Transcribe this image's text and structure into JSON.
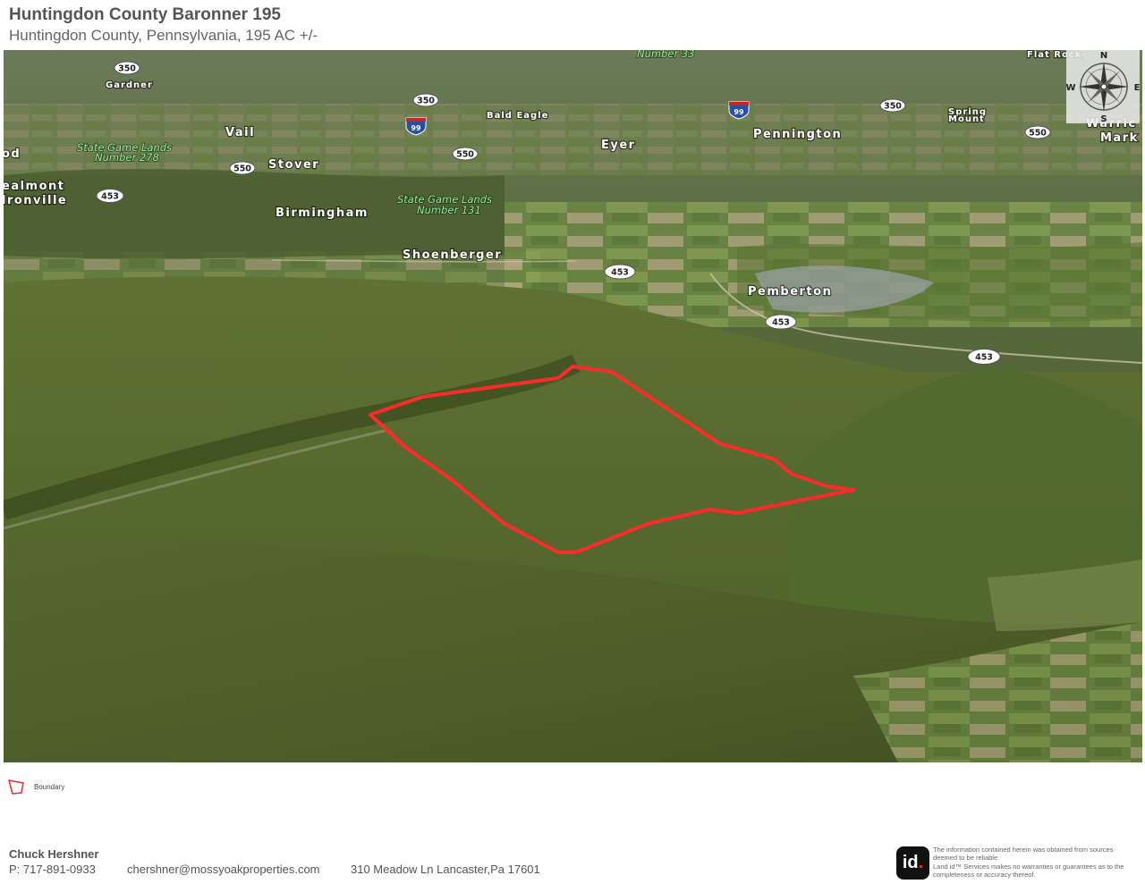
{
  "header": {
    "title": "Huntingdon County Baronner 195",
    "subtitle": "Huntingdon County, Pennsylvania, 195 AC +/-"
  },
  "map": {
    "places": {
      "gardner": "Gardner",
      "vail": "Vail",
      "stover": "Stover",
      "od": "od",
      "healmont": "ealmont",
      "ironville": "lronville",
      "birmingham": "Birmingham",
      "bald_eagle": "Bald Eagle",
      "eyer": "Eyer",
      "pennington": "Pennington",
      "spring_mount_1": "Spring",
      "spring_mount_2": "Mount",
      "flat_rock": "Flat Rock",
      "number_33": "Number 33",
      "warrior_1": "Warric",
      "warrior_2": "Mark",
      "shoenberger": "Shoenberger",
      "pemberton": "Pemberton"
    },
    "game_lands": {
      "sgl278_line1": "State Game Lands",
      "sgl278_line2": "Number 278",
      "sgl131_line1": "State Game Lands",
      "sgl131_line2": "Number 131"
    },
    "shields": {
      "r350a": "350",
      "r350b": "350",
      "r350c": "350",
      "r550a": "550",
      "r550b": "550",
      "r550c": "550",
      "r453a": "453",
      "r453b": "453",
      "r453c": "453",
      "r453d": "453",
      "i99a": "99",
      "i99b": "99"
    },
    "compass": {
      "n": "N",
      "s": "S",
      "e": "E",
      "w": "W"
    },
    "boundary_color": "#ff2a2a"
  },
  "legend": {
    "boundary_label": "Boundary"
  },
  "footer": {
    "name": "Chuck Hershner",
    "phone": "P: 717-891-0933",
    "email": "chershner@mossyoakproperties.com",
    "address": "310 Meadow Ln Lancaster,Pa 17601",
    "disclaimer_l1": "The information contained herein was obtained from sources",
    "disclaimer_l2": "deemed to be reliable.",
    "disclaimer_l3": "Land id™ Services makes no warranties or guarantees as to the",
    "disclaimer_l4": "completeness or accuracy thereof.",
    "logo_text": "id",
    "logo_dot": "."
  }
}
